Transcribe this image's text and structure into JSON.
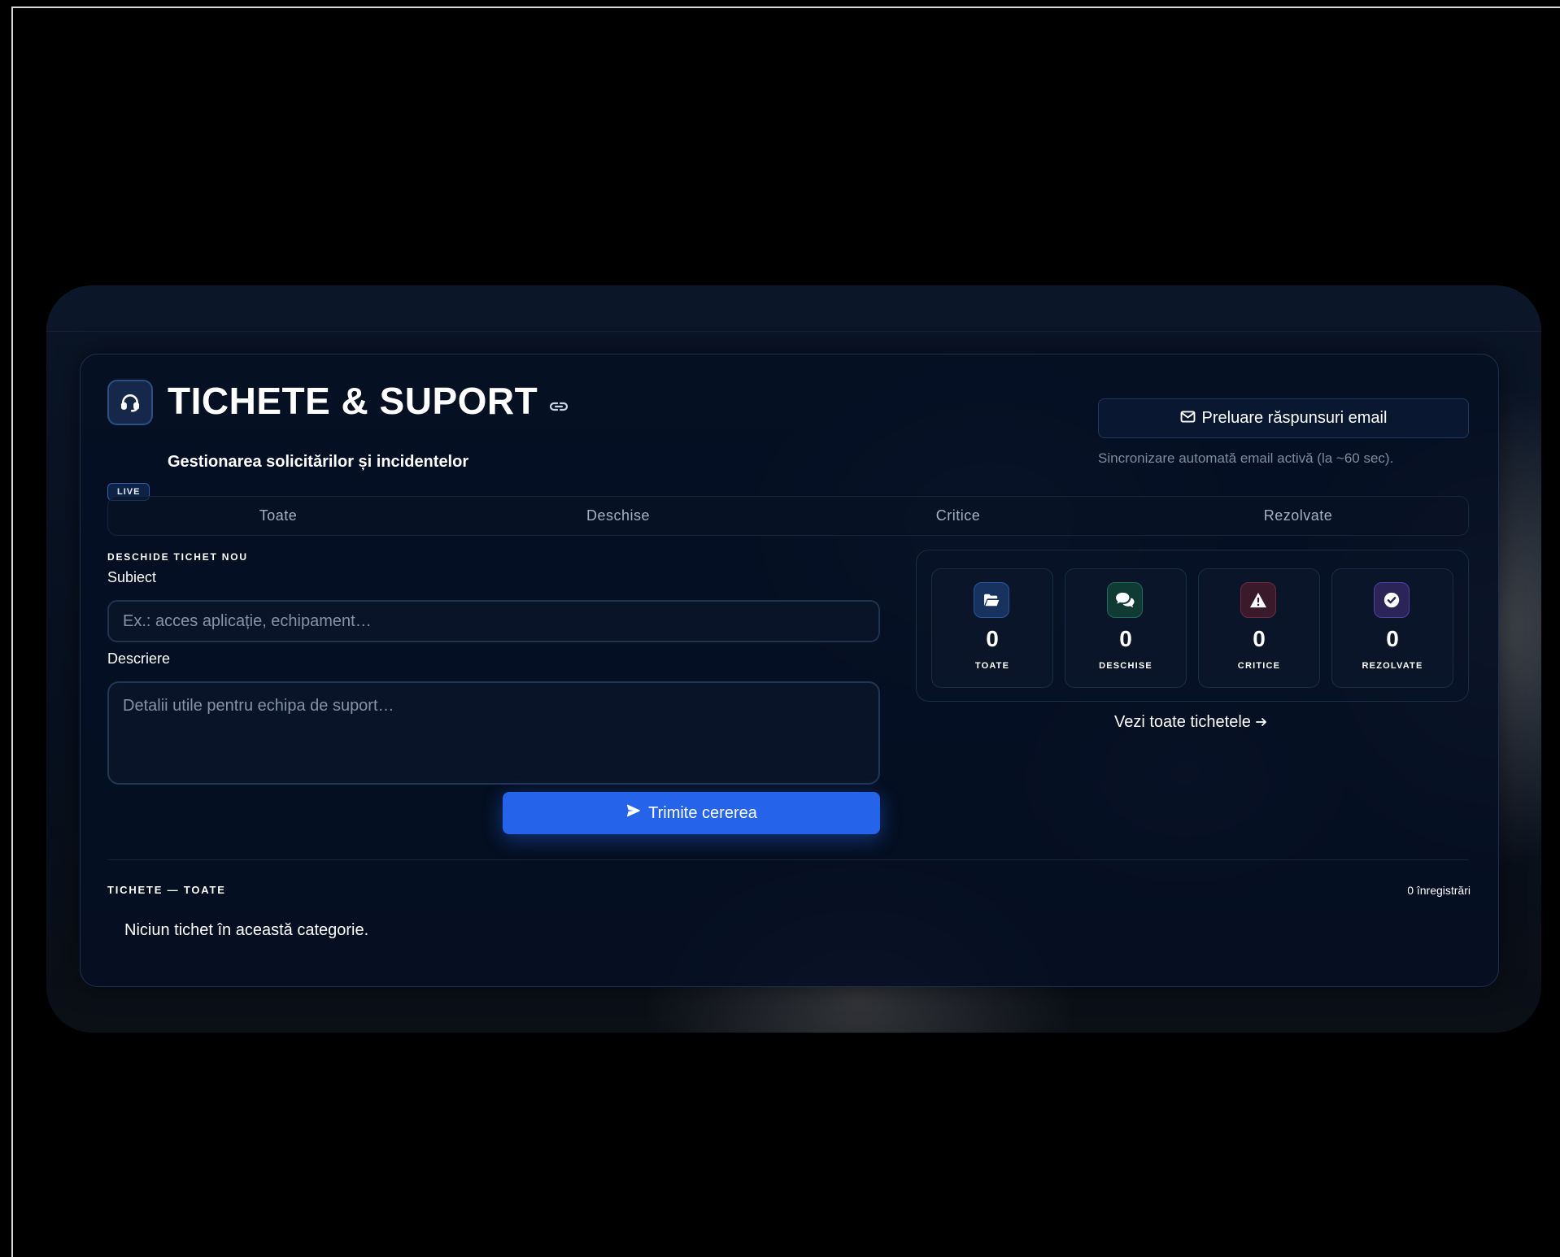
{
  "header": {
    "title": "TICHETE & SUPORT",
    "subtitle": "Gestionarea solicitărilor și incidentelor",
    "live_badge": "LIVE",
    "email_button_label": "Preluare răspunsuri email",
    "sync_note": "Sincronizare automată email activă (la ~60 sec).",
    "icons": {
      "header": "headset-icon",
      "title_link": "link-icon",
      "email": "mail-icon"
    }
  },
  "tabs": [
    {
      "label": "Toate"
    },
    {
      "label": "Deschise"
    },
    {
      "label": "Critice"
    },
    {
      "label": "Rezolvate"
    }
  ],
  "form": {
    "section_label": "DESCHIDE TICHET NOU",
    "subject_label": "Subiect",
    "subject_placeholder": "Ex.: acces aplicație, echipament…",
    "subject_value": "",
    "description_label": "Descriere",
    "description_placeholder": "Detalii utile pentru echipa de suport…",
    "description_value": "",
    "submit_label": "Trimite cererea",
    "submit_icon": "paper-plane-icon"
  },
  "stats": [
    {
      "value": "0",
      "label": "TOATE",
      "icon": "folder-open-icon",
      "bg": "#17325f",
      "border": "#2b55a0",
      "fg": "#ffffff"
    },
    {
      "value": "0",
      "label": "DESCHISE",
      "icon": "comments-icon",
      "bg": "#0f3b34",
      "border": "#1c6a5b",
      "fg": "#ffffff"
    },
    {
      "value": "0",
      "label": "CRITICE",
      "icon": "warning-icon",
      "bg": "#3a1a2a",
      "border": "#6b2a3d",
      "fg": "#ffffff"
    },
    {
      "value": "0",
      "label": "REZOLVATE",
      "icon": "check-circle-icon",
      "bg": "#2a2458",
      "border": "#4b43a0",
      "fg": "#ffffff"
    }
  ],
  "view_all_label": "Vezi toate tichetele",
  "list": {
    "title": "TICHETE — TOATE",
    "count": "0 înregistrări",
    "empty_message": "Niciun tichet în această categorie."
  },
  "colors": {
    "accent": "#2563eb",
    "panel_bg": "#061024",
    "page_bg": "#000000"
  }
}
